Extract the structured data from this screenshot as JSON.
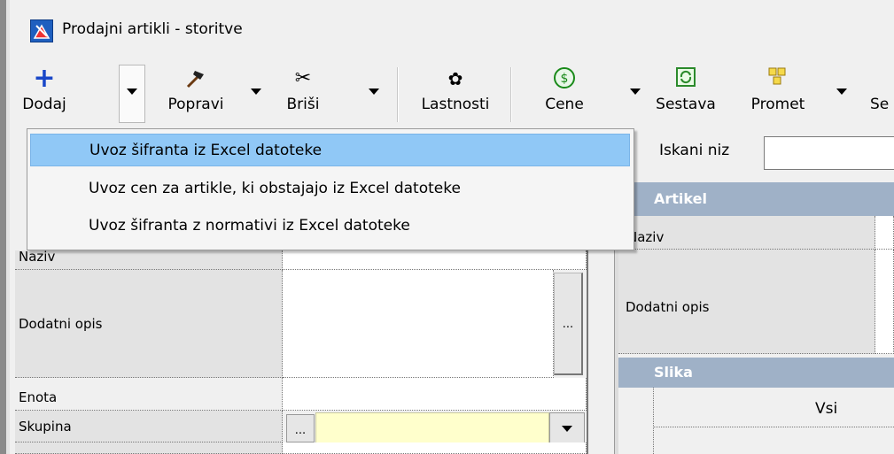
{
  "window": {
    "title": "Prodajni artikli - storitve"
  },
  "toolbar": {
    "dodaj": "Dodaj",
    "popravi": "Popravi",
    "brisi": "Briši",
    "lastnosti": "Lastnosti",
    "cene": "Cene",
    "sestava": "Sestava",
    "promet": "Promet",
    "more": "Se"
  },
  "menu": {
    "items": [
      "Uvoz šifranta iz Excel datoteke",
      "Uvoz cen za artikle, ki obstajajo iz Excel datoteke",
      "Uvoz šifranta z normativi iz Excel datoteke"
    ]
  },
  "left_grid": {
    "naziv": "Naziv",
    "dodatni_opis": "Dodatni opis",
    "enota": "Enota",
    "skupina": "Skupina",
    "ellipsis": "..."
  },
  "right_panel": {
    "search_label": "Iskani niz",
    "section_artikel": "Artikel",
    "naziv": "Naziv",
    "dodatni_opis": "Dodatni opis",
    "section_slika": "Slika",
    "vsi": "Vsi"
  },
  "colors": {
    "menu_highlight": "#90c8f6",
    "section_header": "#9fb1c7",
    "skupina_value": "#ffffcc"
  }
}
